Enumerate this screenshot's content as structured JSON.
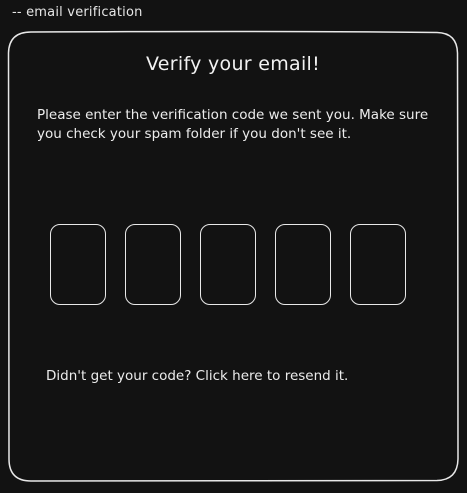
{
  "section_label": "-- email verification",
  "card": {
    "title": "Verify your email!",
    "instructions": "Please enter the verification code we sent you. Make sure you check your spam folder if you don't see it.",
    "code_boxes": [
      "",
      "",
      "",
      "",
      ""
    ],
    "resend_text": "Didn't get your code? Click here to resend it."
  },
  "colors": {
    "background": "#121212",
    "stroke": "#e8e8e8",
    "text": "#ececec"
  }
}
